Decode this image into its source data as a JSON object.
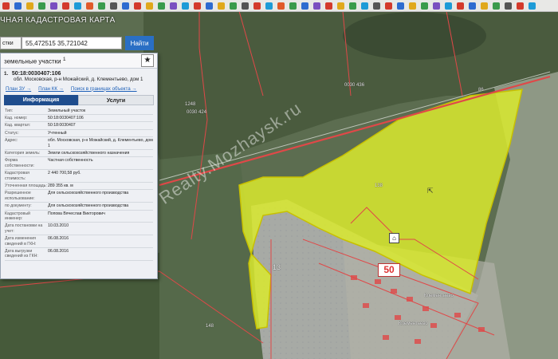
{
  "toolbar": {
    "icon_colors": [
      "#d33a2c",
      "#2d6bd0",
      "#e0a81c",
      "#3a9b4c",
      "#7a4fc0",
      "#d33a2c",
      "#1d9bd7",
      "#e05a2a",
      "#3a9b4c",
      "#555555",
      "#2d6bd0",
      "#d33a2c",
      "#e0a81c",
      "#3a9b4c",
      "#7a4fc0",
      "#1d9bd7",
      "#d33a2c",
      "#2d6bd0",
      "#e0a81c",
      "#3a9b4c",
      "#555555",
      "#d33a2c",
      "#1d9bd7",
      "#e05a2a",
      "#3a9b4c",
      "#2d6bd0",
      "#7a4fc0",
      "#d33a2c",
      "#e0a81c",
      "#3a9b4c",
      "#1d9bd7",
      "#555555",
      "#d33a2c",
      "#2d6bd0",
      "#e0a81c",
      "#3a9b4c",
      "#7a4fc0",
      "#1d9bd7",
      "#d33a2c",
      "#2d6bd0",
      "#e0a81c",
      "#3a9b4c",
      "#555555",
      "#d33a2c",
      "#1d9bd7"
    ]
  },
  "app": {
    "title": "ЧНАЯ КАДАСТРОВАЯ КАРТА"
  },
  "search": {
    "type_label": "стки",
    "value": "55,472515 35,721042",
    "button": "Найти"
  },
  "panel": {
    "header": "земельные участки",
    "header_count": "1",
    "star": "★",
    "entry": {
      "num": "1.",
      "cadastral": "50:18:0030407:106",
      "address": "обл. Московская, р-н Можайский, д. Клементьево, дом 1"
    },
    "links": [
      "План ЗУ →",
      "План КК →",
      "Поиск в границах объекта →"
    ],
    "tabs": {
      "info": "Информация",
      "services": "Услуги"
    },
    "rows": [
      {
        "k": "Тип:",
        "v": "Земельный участок",
        "blue": false
      },
      {
        "k": "Кад. номер:",
        "v": "50:18:0030407:106",
        "blue": true
      },
      {
        "k": "Кад. квартал:",
        "v": "50:18:0030407",
        "blue": true
      },
      {
        "k": "Статус:",
        "v": "Учтенный",
        "blue": false
      },
      {
        "k": "Адрес:",
        "v": "обл. Московская, р-н Можайский, д. Клементьево, дом 1",
        "blue": false
      },
      {
        "k": "Категория земель:",
        "v": "Земли сельскохозяйственного назначения",
        "blue": false
      },
      {
        "k": "Форма собственности:",
        "v": "Частная собственность",
        "blue": false
      },
      {
        "k": "Кадастровая стоимость:",
        "v": "2 440 700,58 руб.",
        "blue": false
      },
      {
        "k": "Уточненная площадь:",
        "v": "289 355 кв. м",
        "blue": false
      },
      {
        "k": "Разрешенное использование:",
        "v": "Для сельскохозяйственного производства",
        "blue": false
      },
      {
        "k": "по документу:",
        "v": "Для сельскохозяйственного производства",
        "blue": false
      },
      {
        "k": "Кадастровый инженер:",
        "v": "Попова Вячеслав Викторович",
        "blue": false
      },
      {
        "k": "Дата постановки на учет:",
        "v": "10.03.2010",
        "blue": false
      },
      {
        "k": "Дата изменения сведений в ГКН:",
        "v": "06.08.2016",
        "blue": false
      },
      {
        "k": "Дата выгрузки сведений из ГКН:",
        "v": "06.08.2016",
        "blue": false
      }
    ]
  },
  "map": {
    "labels": {
      "a": "0030 436",
      "b": "1248",
      "c": "0030 424",
      "d": "86",
      "e": "148",
      "f": "138",
      "g": "13",
      "h": "Клементьево",
      "i": "Клементьево"
    },
    "big_tag": "50",
    "watermark": "Realty.Mozhaysk.ru",
    "highlight_color": "#d9ea2e",
    "road_color": "#e04848"
  }
}
